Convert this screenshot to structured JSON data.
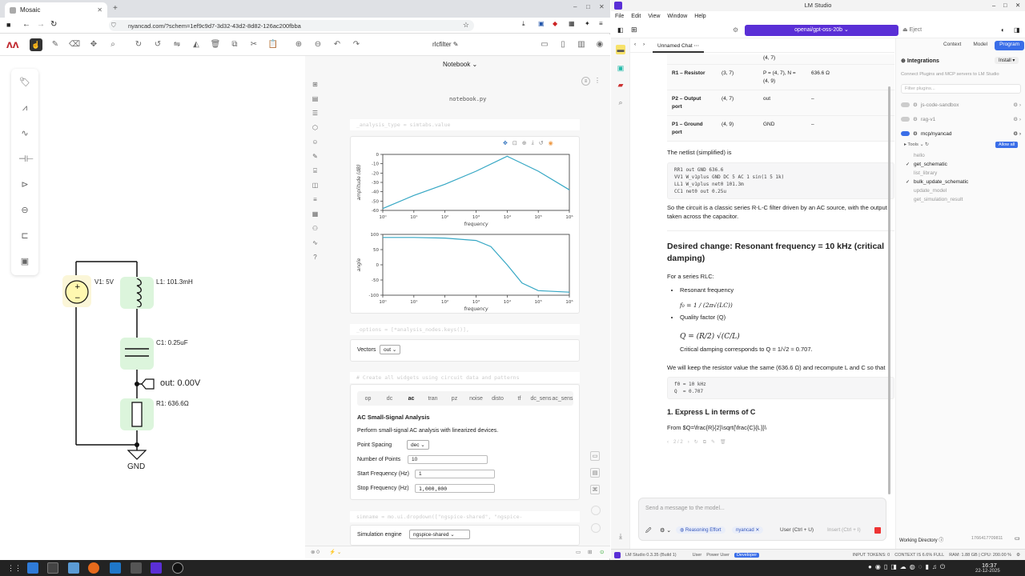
{
  "browser": {
    "tab_title": "Mosaic",
    "url": "nyancad.com/?schem=1ef9c9d7-3d32-43d2-8d82-126ac200fbba"
  },
  "app": {
    "doc_title": "rlcfilter",
    "notebook_label": "Notebook",
    "file": "notebook.py"
  },
  "schematic": {
    "v1": "V1: 5V",
    "l1": "L1: 101.3mH",
    "c1": "C1: 0.25uF",
    "out": "out: 0.00V",
    "r1": "R1: 636.6Ω",
    "gnd": "GND"
  },
  "notebook": {
    "code1": "_analysis_type = simtabs.value",
    "code2": "_options = [*analysis_nodes.keys()],",
    "code3": "# Create all widgets using circuit data and patterns",
    "code4": "simname = mo.ui.dropdown([\"ngspice-shared\", \"ngspice-",
    "vectors_label": "Vectors",
    "vectors_value": "out",
    "tabs": [
      "op",
      "dc",
      "ac",
      "tran",
      "pz",
      "noise",
      "disto",
      "tf",
      "dc_sens",
      "ac_sens"
    ],
    "ac_title": "AC Small-Signal Analysis",
    "ac_desc": "Perform small-signal AC analysis with linearized devices.",
    "point_spacing_label": "Point Spacing",
    "point_spacing": "dec",
    "num_points_label": "Number of Points",
    "num_points": "10",
    "start_label": "Start Frequency (Hz)",
    "start": "1",
    "stop_label": "Stop Frequency (Hz)",
    "stop": "1,000,000",
    "engine_label": "Simulation engine",
    "engine": "ngspice-shared"
  },
  "chart_data": [
    {
      "type": "line",
      "ylabel": "amplitude (dB)",
      "xlabel": "frequency",
      "xscale": "log",
      "xlim": [
        1,
        1000000
      ],
      "ylim": [
        -60,
        0
      ],
      "xticks": [
        "10⁰",
        "10¹",
        "10²",
        "10³",
        "10⁴",
        "10⁵",
        "10⁶"
      ],
      "yticks": [
        "0",
        "-10",
        "-20",
        "-30",
        "-40",
        "-50",
        "-60"
      ],
      "x": [
        1,
        10,
        100,
        1000,
        10000,
        100000,
        1000000
      ],
      "y": [
        -58,
        -44,
        -32,
        -18,
        -2,
        -18,
        -38
      ],
      "color": "#35a7c4"
    },
    {
      "type": "line",
      "ylabel": "angle",
      "xlabel": "frequency",
      "xscale": "log",
      "xlim": [
        1,
        1000000
      ],
      "ylim": [
        -100,
        100
      ],
      "xticks": [
        "10⁰",
        "10¹",
        "10²",
        "10³",
        "10⁴",
        "10⁵",
        "10⁶"
      ],
      "yticks": [
        "100",
        "50",
        "0",
        "-50",
        "-100"
      ],
      "x": [
        1,
        10,
        100,
        1000,
        3000,
        10000,
        30000,
        100000,
        1000000
      ],
      "y": [
        90,
        90,
        88,
        80,
        60,
        0,
        -60,
        -85,
        -90
      ],
      "color": "#35a7c4"
    }
  ],
  "lm": {
    "title": "LM Studio",
    "menu": [
      "File",
      "Edit",
      "View",
      "Window",
      "Help"
    ],
    "model": "openai/gpt-oss-20b",
    "eject": "Eject",
    "chat_tab": "Unnamed Chat",
    "right_tabs": [
      "Context",
      "Model",
      "Program"
    ],
    "table": [
      {
        "name": "",
        "nodes": "",
        "pins": "(4, 7)",
        "val": ""
      },
      {
        "name": "R1 – Resistor",
        "nodes": "(3, 7)",
        "pins": "P = (4, 7), N = (4, 9)",
        "val": "636.6 Ω"
      },
      {
        "name": "P2 – Output port",
        "nodes": "(4, 7)",
        "pins": "out",
        "val": "–"
      },
      {
        "name": "P1 – Ground port",
        "nodes": "(4, 9)",
        "pins": "GND",
        "val": "–"
      }
    ],
    "netlist_intro": "The netlist (simplified) is",
    "netlist": "RR1 out GND 636.6\nVV1 W_v1plus GND DC 5 AC 1 sin(1 5 1k)\nLL1 W_v1plus net0 101.3m\nCC1 net0 out 0.25u",
    "para1": "So the circuit is a classic series R-L-C filter driven by an AC source, with the output taken across the capacitor.",
    "h_change": "Desired change: Resonant frequency = 10 kHz (critical damping)",
    "for_series": "For a series RLC:",
    "bullet1": "Resonant frequency",
    "bullet2": "Quality factor (Q)",
    "f0_formula": "f₀ = 1 / (2π√(LC))",
    "q_formula": "Q = (R/2) √(C/L)",
    "crit": "Critical damping corresponds to Q = 1/√2 ≈ 0.707.",
    "para2": "We will keep the resistor value the same (636.6 Ω) and recompute L and C so that",
    "code_f0": "f0 = 10 kHz\nQ  = 0.707",
    "h_express": "1. Express L in terms of C",
    "from_line": "From $Q=\\frac{R}{2}\\sqrt{\\frac{C}{L}}\\",
    "page_counter": "2 / 2",
    "input_placeholder": "Send a message to the model...",
    "reasoning": "Reasoning Effort",
    "chip_nyancad": "nyancad",
    "user_label": "User (Ctrl + U)",
    "insert_label": "Insert (Ctrl + I)",
    "integrations": "Integrations",
    "install": "Install",
    "connect_text": "Connect Plugins and MCP servers to LM Studio",
    "filter_placeholder": "Filter plugins...",
    "plugins": [
      "js-code-sandbox",
      "rag-v1",
      "mcp/nyancad"
    ],
    "tools_label": "Tools",
    "allow_all": "Allow all",
    "tools": [
      {
        "name": "hello",
        "on": false
      },
      {
        "name": "get_schematic",
        "on": true
      },
      {
        "name": "list_library",
        "on": false
      },
      {
        "name": "bulk_update_schematic",
        "on": true
      },
      {
        "name": "update_model",
        "on": false
      },
      {
        "name": "get_simulation_result",
        "on": false
      }
    ],
    "working_dir": "Working Directory",
    "working_id": "1766417709811",
    "status": {
      "version": "LM Studio 0.3.35 (Build 1)",
      "modes": [
        "User",
        "Power User",
        "Developer"
      ],
      "tokens": "INPUT TOKENS: 0",
      "context": "CONTEXT IS 6.6% FULL",
      "ram": "RAM: 1.88 GB | CPU: 200.00 %"
    }
  },
  "taskbar": {
    "time": "16:37",
    "date": "22-12-2025"
  }
}
